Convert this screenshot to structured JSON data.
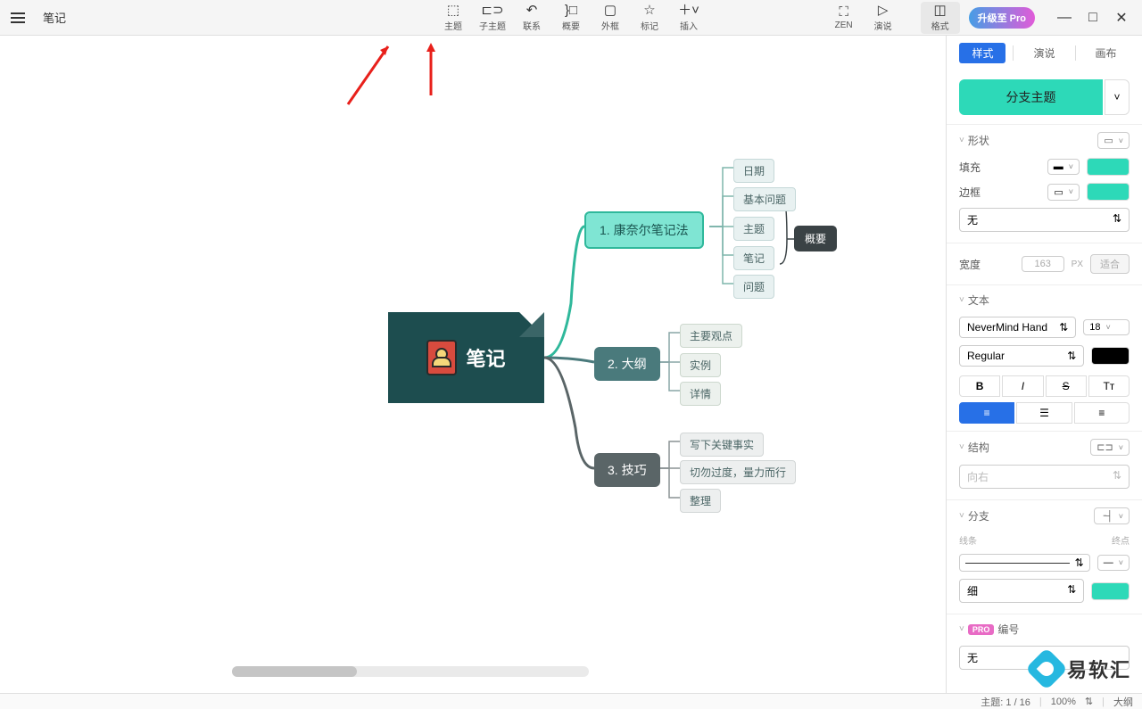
{
  "titlebar": {
    "doc_title": "笔记",
    "tools": [
      {
        "icon": "⬚",
        "label": "主题"
      },
      {
        "icon": "⊏⊃",
        "label": "子主题"
      },
      {
        "icon": "↶",
        "label": "联系"
      },
      {
        "icon": "}□",
        "label": "概要"
      },
      {
        "icon": "▢",
        "label": "外框"
      },
      {
        "icon": "☆",
        "label": "标记"
      },
      {
        "icon": "＋",
        "label": "插入"
      }
    ],
    "tools_right": [
      {
        "icon": "⛶",
        "label": "ZEN"
      },
      {
        "icon": "▷",
        "label": "演说"
      },
      {
        "icon": "◫",
        "label": "格式",
        "active": true
      }
    ],
    "pro_badge": "升级至 Pro"
  },
  "panel": {
    "tabs": [
      "样式",
      "演说",
      "画布"
    ],
    "branch_button": "分支主题",
    "sections": {
      "shape": {
        "title": "形状",
        "fill_label": "填充",
        "border_label": "边框",
        "line_style": "无",
        "fill_color": "#000000",
        "fill_swatch": "#2dd9b8",
        "border_swatch": "#2dd9b8"
      },
      "width": {
        "title": "宽度",
        "value": "163",
        "unit": "PX",
        "fit_label": "适合"
      },
      "text": {
        "title": "文本",
        "font": "NeverMind Hand",
        "size": "18",
        "weight": "Regular",
        "color": "#000000",
        "buttons": [
          "B",
          "I",
          "S",
          "Tт"
        ]
      },
      "structure": {
        "title": "结构",
        "direction": "向右"
      },
      "branch": {
        "title": "分支",
        "line_label": "线条",
        "end_label": "终点",
        "thickness": "细",
        "color": "#2dd9b8"
      },
      "number": {
        "title": "编号",
        "value": "无",
        "pro": "PRO"
      }
    }
  },
  "mindmap": {
    "root": "笔记",
    "branch1": {
      "label": "1. 康奈尔笔记法",
      "leaves": [
        "日期",
        "基本问题",
        "主题",
        "笔记",
        "问题"
      ],
      "summary": "概要"
    },
    "branch2": {
      "label": "2. 大纲",
      "leaves": [
        "主要观点",
        "实例",
        "详情"
      ]
    },
    "branch3": {
      "label": "3. 技巧",
      "leaves": [
        "写下关键事实",
        "切勿过度，量力而行",
        "整理"
      ]
    }
  },
  "statusbar": {
    "topics": "主题: 1 / 16",
    "zoom": "100%",
    "mode": "大纲"
  },
  "watermark": "易软汇"
}
